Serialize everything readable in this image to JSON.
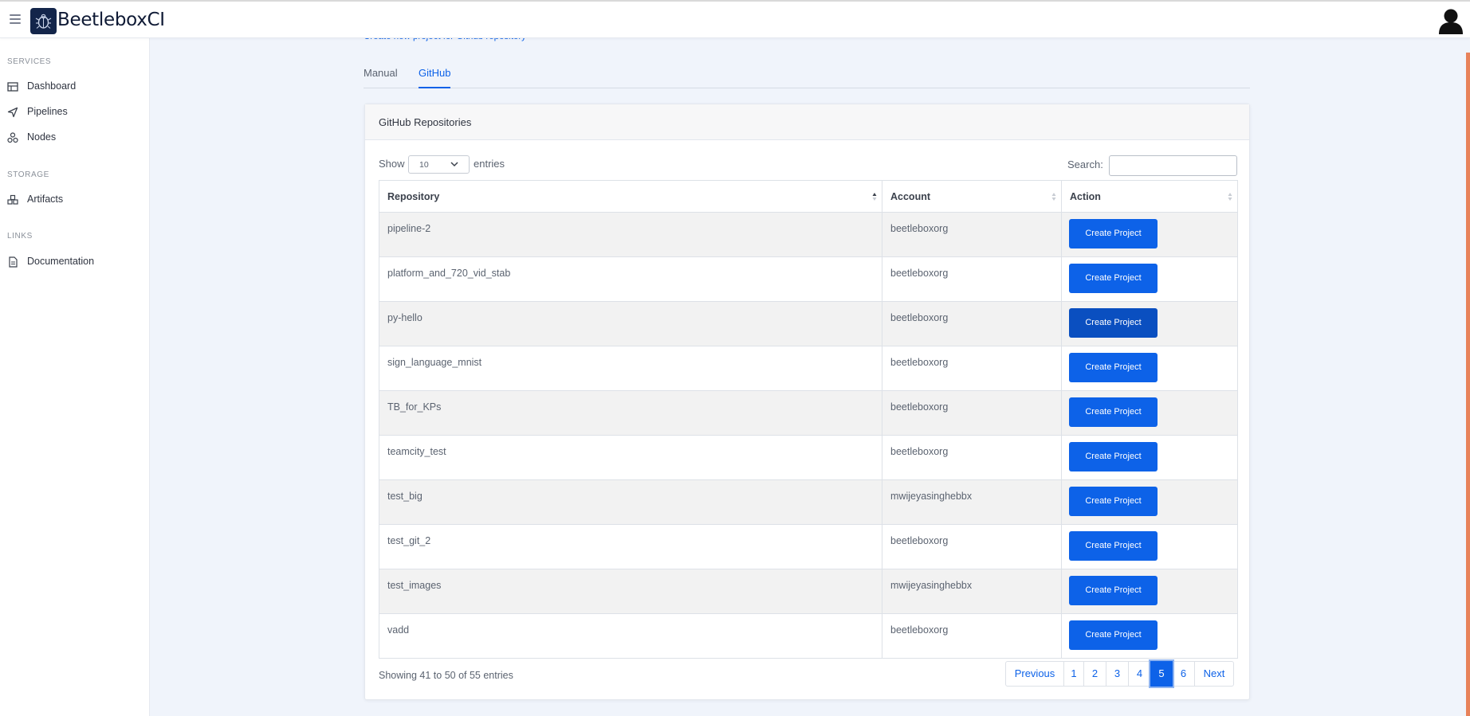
{
  "header": {
    "brand": "BeetleboxCI",
    "menu_icon": "hamburger-icon",
    "logo_icon": "beetle-logo-icon",
    "avatar_icon": "user-avatar-icon"
  },
  "sidebar": {
    "sections": [
      {
        "label": "SERVICES",
        "items": [
          {
            "label": "Dashboard",
            "icon": "table-icon"
          },
          {
            "label": "Pipelines",
            "icon": "send-icon"
          },
          {
            "label": "Nodes",
            "icon": "nodes-icon"
          }
        ]
      },
      {
        "label": "STORAGE",
        "items": [
          {
            "label": "Artifacts",
            "icon": "boxes-icon"
          }
        ]
      },
      {
        "label": "LINKS",
        "items": [
          {
            "label": "Documentation",
            "icon": "file-icon"
          }
        ]
      }
    ]
  },
  "main": {
    "top_link": "Create new project for Github repository",
    "tabs": [
      {
        "label": "Manual",
        "active": false
      },
      {
        "label": "GitHub",
        "active": true
      }
    ],
    "card": {
      "title": "GitHub Repositories",
      "show_label": "Show",
      "entries_value": "10",
      "entries_label": "entries",
      "search_label": "Search:",
      "search_value": "",
      "columns": [
        "Repository",
        "Account",
        "Action"
      ],
      "rows": [
        {
          "repository": "pipeline-2",
          "account": "beetleboxorg",
          "action": "Create Project"
        },
        {
          "repository": "platform_and_720_vid_stab",
          "account": "beetleboxorg",
          "action": "Create Project"
        },
        {
          "repository": "py-hello",
          "account": "beetleboxorg",
          "action": "Create Project"
        },
        {
          "repository": "sign_language_mnist",
          "account": "beetleboxorg",
          "action": "Create Project"
        },
        {
          "repository": "TB_for_KPs",
          "account": "beetleboxorg",
          "action": "Create Project"
        },
        {
          "repository": "teamcity_test",
          "account": "beetleboxorg",
          "action": "Create Project"
        },
        {
          "repository": "test_big",
          "account": "mwijeyasinghebbx",
          "action": "Create Project"
        },
        {
          "repository": "test_git_2",
          "account": "beetleboxorg",
          "action": "Create Project"
        },
        {
          "repository": "test_images",
          "account": "mwijeyasinghebbx",
          "action": "Create Project"
        },
        {
          "repository": "vadd",
          "account": "beetleboxorg",
          "action": "Create Project"
        }
      ],
      "info": "Showing 41 to 50 of 55 entries",
      "pagination": {
        "previous": "Previous",
        "pages": [
          "1",
          "2",
          "3",
          "4",
          "5",
          "6"
        ],
        "current": "5",
        "next": "Next"
      }
    }
  },
  "colors": {
    "accent": "#0d62e8",
    "brand_dark": "#13254a",
    "scroll_accent": "#e8825a"
  }
}
